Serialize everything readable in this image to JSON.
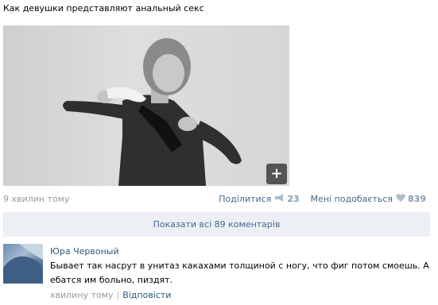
{
  "post": {
    "text": "Как девушки представляют анальный секс",
    "time": "9 хвилин тому",
    "share_label": "Поділитися",
    "share_count": "23",
    "like_label": "Мені подобається",
    "like_count": "839",
    "expand_icon": "plus-icon"
  },
  "comments": {
    "show_all_label": "Показати всі 89 коментарів",
    "items": [
      {
        "author": "Юра Червоный",
        "text": "Бывает так насрут в унитаз какахами толщиной с ногу, что фиг потом смоешь. А ебатся им больно, пиздят.",
        "time": "хвилину тому",
        "reply_label": "Відповісти"
      }
    ]
  }
}
